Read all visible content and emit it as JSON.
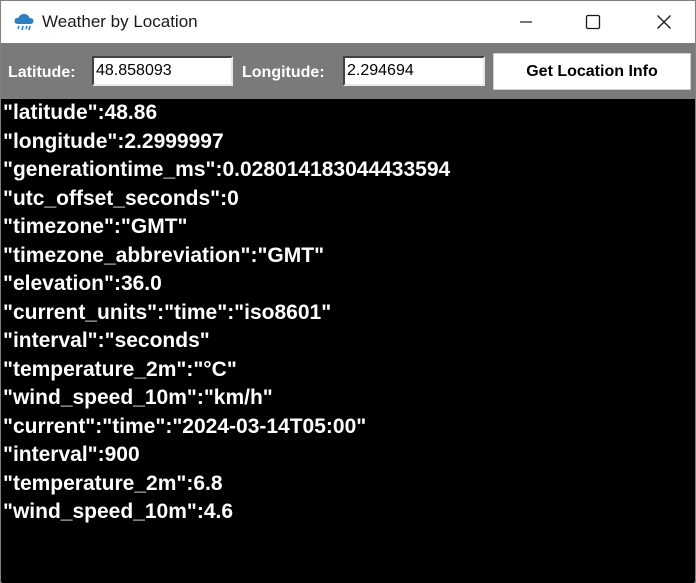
{
  "window": {
    "title": "Weather by Location",
    "app_icon": "rain-cloud-icon"
  },
  "toolbar": {
    "latitude_label": "Latitude:",
    "latitude_value": "48.858093",
    "longitude_label": "Longitude:",
    "longitude_value": "2.294694",
    "button_label": "Get Location Info"
  },
  "output": {
    "lines": [
      "\"latitude\":48.86",
      "\"longitude\":2.2999997",
      "\"generationtime_ms\":0.028014183044433594",
      "\"utc_offset_seconds\":0",
      "\"timezone\":\"GMT\"",
      "\"timezone_abbreviation\":\"GMT\"",
      "\"elevation\":36.0",
      "\"current_units\":\"time\":\"iso8601\"",
      "\"interval\":\"seconds\"",
      "\"temperature_2m\":\"°C\"",
      "\"wind_speed_10m\":\"km/h\"",
      "\"current\":\"time\":\"2024-03-14T05:00\"",
      "\"interval\":900",
      "\"temperature_2m\":6.8",
      "\"wind_speed_10m\":4.6"
    ]
  }
}
